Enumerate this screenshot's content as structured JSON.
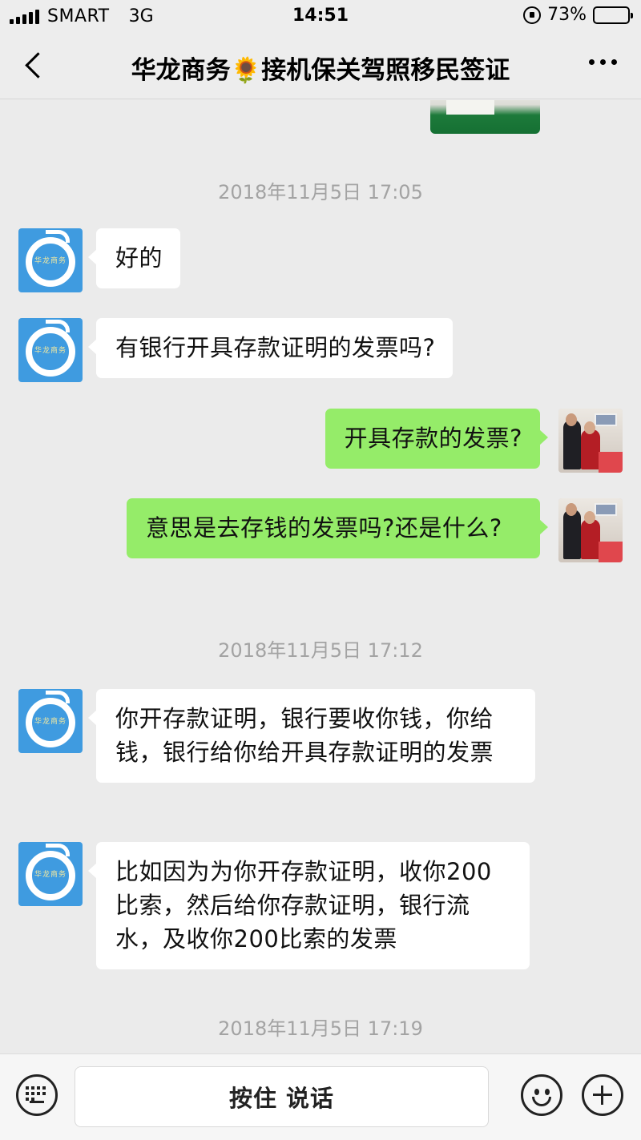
{
  "status_bar": {
    "carrier": "SMART",
    "network": "3G",
    "time": "14:51",
    "battery_percent": "73%",
    "battery_level": 0.73
  },
  "nav": {
    "title": "华龙商务🌻接机保关驾照移民签证"
  },
  "contact_avatar": {
    "text": "华龙商务"
  },
  "messages": [
    {
      "type": "time",
      "text": "2018年11月5日 17:05"
    },
    {
      "type": "msg",
      "side": "left",
      "text": "好的"
    },
    {
      "type": "msg",
      "side": "left",
      "text": "有银行开具存款证明的发票吗?"
    },
    {
      "type": "msg",
      "side": "right",
      "text": "开具存款的发票?"
    },
    {
      "type": "msg",
      "side": "right",
      "text": "意思是去存钱的发票吗?还是什么?"
    },
    {
      "type": "time",
      "text": "2018年11月5日 17:12"
    },
    {
      "type": "msg",
      "side": "left",
      "text": "你开存款证明，银行要收你钱，你给钱，银行给你给开具存款证明的发票"
    },
    {
      "type": "msg",
      "side": "left",
      "text": "比如因为为你开存款证明，收你200比索，然后给你存款证明，银行流水，及收你200比索的发票"
    },
    {
      "type": "time",
      "text": "2018年11月5日 17:19"
    }
  ],
  "input_bar": {
    "voice_label": "按住 说话"
  },
  "colors": {
    "background": "#ebebeb",
    "sent_bubble": "#95ec69",
    "received_bubble": "#ffffff",
    "timestamp": "#a3a3a3"
  }
}
